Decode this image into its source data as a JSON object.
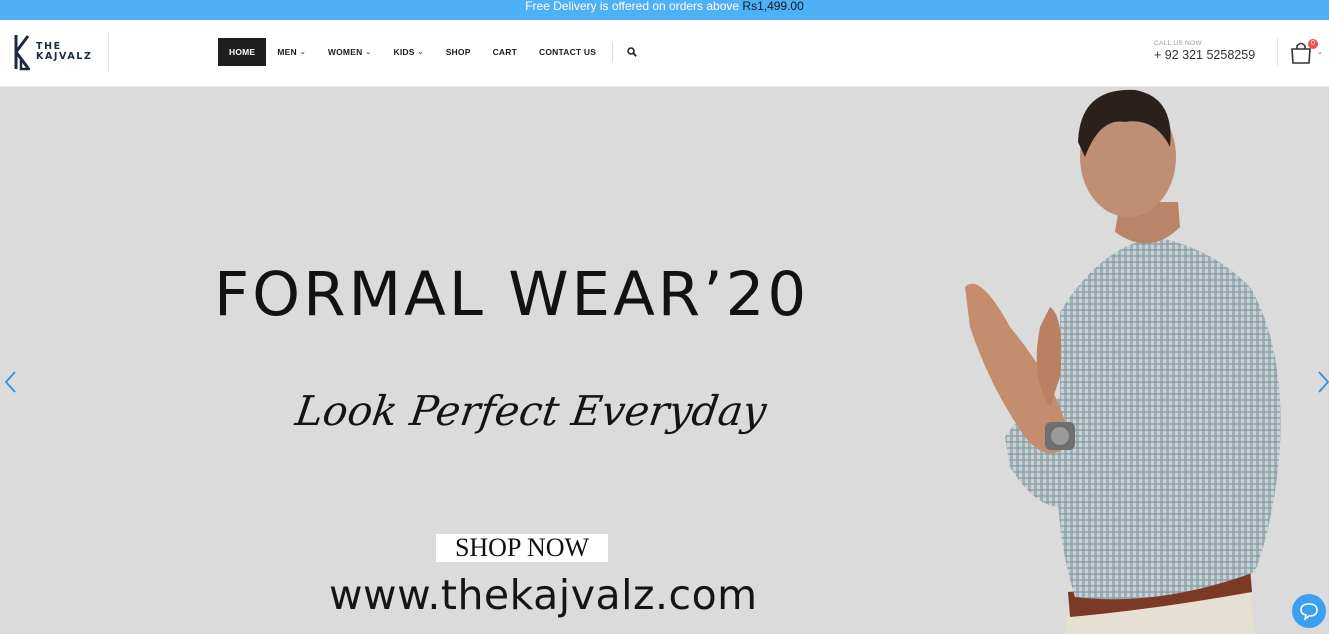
{
  "topbar": {
    "message": "Free Delivery is offered on orders above ",
    "amount": "Rs1,499.00"
  },
  "logo": {
    "line1": "THE",
    "line2": "KAJVALZ"
  },
  "nav": {
    "items": [
      {
        "label": "HOME",
        "active": true
      },
      {
        "label": "MEN",
        "dropdown": true
      },
      {
        "label": "WOMEN",
        "dropdown": true
      },
      {
        "label": "KIDS",
        "dropdown": true
      },
      {
        "label": "SHOP"
      },
      {
        "label": "CART"
      },
      {
        "label": "CONTACT US"
      }
    ],
    "search_icon": "search-icon"
  },
  "contact": {
    "label": "CALL US NOW",
    "phone": "+ 92 321 5258259"
  },
  "cart": {
    "count": "0",
    "icon": "shopping-bag-icon"
  },
  "hero": {
    "title": "FORMAL WEAR’20",
    "script": "Look Perfect Everyday",
    "button": "SHOP NOW",
    "url": "www.thekajvalz.com"
  },
  "colors": {
    "topbar": "#4fb0f5",
    "hero_bg": "#dbdbdb",
    "active_nav": "#1e1e1e",
    "accent_arrow": "#3a8fd8",
    "badge": "#f0504a"
  }
}
